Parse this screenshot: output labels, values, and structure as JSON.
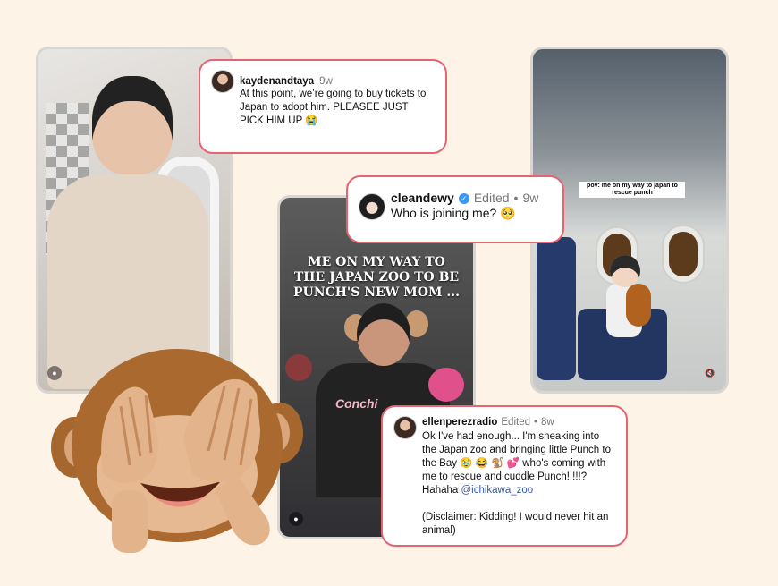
{
  "comments": [
    {
      "username": "kaydenandtaya",
      "time": "9w",
      "text": "At this point, we’re going to buy tickets to Japan to adopt him. PLEASEE JUST PICK HIM UP 😭"
    },
    {
      "username": "cleandewy",
      "edited": "Edited",
      "separator": "•",
      "time": "9w",
      "text": "Who is joining me? 🥺"
    },
    {
      "username": "ellenperezradio",
      "edited": "Edited",
      "separator": "•",
      "time": "8w",
      "text_main": "Ok I've had enough... I'm sneaking into the Japan zoo and bringing little Punch to the Bay 🥹 😂 🐒 💕 who's coming with me to rescue and cuddle Punch!!!!!? Hahaha ",
      "mention": "@ichikawa_zoo",
      "disclaimer": "(Disclaimer: Kidding! I would never hit an animal)"
    }
  ],
  "videos": {
    "middle_overlay": "ME ON MY WAY TO THE JAPAN ZOO TO BE PUNCH'S NEW MOM ...",
    "middle_shirt_text": "Conchi",
    "right_caption": "pov: me on my way to japan to rescue punch"
  },
  "icons": {
    "profile": "profile-icon",
    "mute": "mute-icon",
    "verified": "verified-badge-icon",
    "monkey": "see-no-evil-monkey-icon"
  },
  "colors": {
    "background": "#fdf3e6",
    "bubble_border": "#e56472",
    "mention": "#355aa8"
  }
}
